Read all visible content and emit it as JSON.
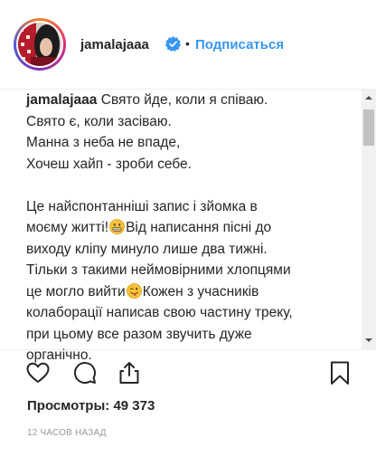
{
  "header": {
    "username": "jamalajaaa",
    "separator": "•",
    "follow_label": "Подписаться"
  },
  "caption": {
    "username": "jamalajaaa",
    "lines": [
      "Свято йде, коли я співаю.",
      "Свято є, коли засіваю.",
      "Манна з неба не впаде,",
      "Хочеш хайп - зроби себе.",
      "",
      "Це найспонтанніші запис і зйомка в",
      "моєму житті!",
      "Від написання пісні до",
      "виходу кліпу минуло лише два тижні.",
      "Тільки з такими неймовірними хлопцями",
      "це могло вийти",
      "Кожен з учасників",
      "колаборації написав свою частину треку,",
      "при цьому все разом звучить дуже",
      "органічно."
    ]
  },
  "stats": {
    "views_label": "Просмотры:",
    "views_count": "49 373"
  },
  "timestamp": "12 ЧАСОВ НАЗАД",
  "colors": {
    "link_blue": "#3897f0",
    "text": "#262626",
    "muted": "#999999",
    "verified": "#3897f0"
  },
  "icons": [
    "verified-badge-icon",
    "grinning-emoji-icon",
    "winking-tongue-emoji-icon",
    "heart-icon",
    "comment-icon",
    "share-icon",
    "bookmark-icon"
  ]
}
